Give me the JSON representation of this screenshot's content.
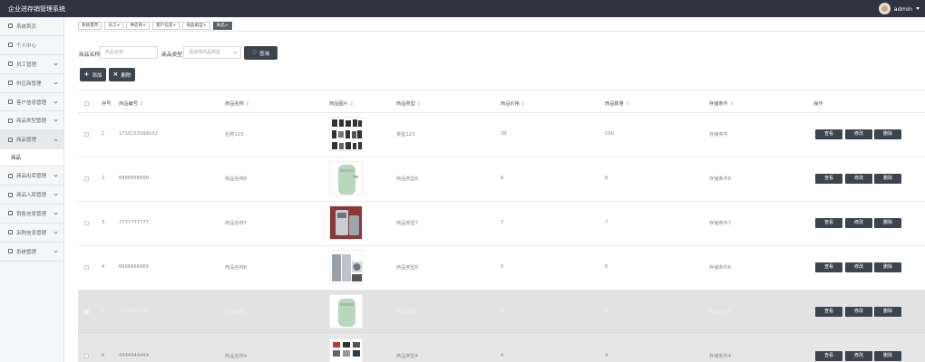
{
  "app": {
    "title": "企业进存销管理系统",
    "user": "admin"
  },
  "sidebar": {
    "items_top": [
      {
        "label": "系统首页"
      },
      {
        "label": "个人中心"
      },
      {
        "label": "员工管理"
      },
      {
        "label": "供应商管理"
      },
      {
        "label": "客户信息管理"
      },
      {
        "label": "商品类型管理"
      },
      {
        "label": "商品管理"
      }
    ],
    "sub_label": "商品",
    "items_bottom": [
      {
        "label": "商品出库管理"
      },
      {
        "label": "商品入库管理"
      },
      {
        "label": "销售信息管理"
      },
      {
        "label": "采购信息管理"
      },
      {
        "label": "系统管理"
      }
    ]
  },
  "tabs": [
    {
      "label": "系统首页"
    },
    {
      "label": "员工×"
    },
    {
      "label": "供应商×"
    },
    {
      "label": "客户信息×"
    },
    {
      "label": "商品类型×"
    },
    {
      "label": "商品×"
    }
  ],
  "search": {
    "name_label": "商品名称",
    "name_placeholder": "商品名称",
    "type_label": "商品类型",
    "type_placeholder": "请选择商品类型",
    "query_button": "查询"
  },
  "toolbar": {
    "add_label": "添加",
    "delete_label": "删除"
  },
  "table": {
    "headers": [
      "序号",
      "商品编号",
      "商品名称",
      "商品图片",
      "商品类型",
      "商品价格",
      "商品数量",
      "存储条件",
      "操作"
    ],
    "actions": {
      "view": "查看",
      "edit": "修改",
      "delete": "删除"
    },
    "rows": [
      {
        "index": "1",
        "code": "1710153399102",
        "name": "名称123",
        "type": "类型123",
        "price": "39",
        "qty": "100",
        "storage": "存储条件"
      },
      {
        "index": "2",
        "code": "8888888888",
        "name": "商品名称8",
        "type": "商品类型8",
        "price": "8",
        "qty": "8",
        "storage": "存储条件8"
      },
      {
        "index": "3",
        "code": "7777777777",
        "name": "商品名称7",
        "type": "商品类型7",
        "price": "7",
        "qty": "7",
        "storage": "存储条件7"
      },
      {
        "index": "4",
        "code": "6666666666",
        "name": "商品名称6",
        "type": "商品类型6",
        "price": "6",
        "qty": "6",
        "storage": "存储条件6"
      },
      {
        "index": "5",
        "code": "5555555555",
        "name": "商品名称5",
        "type": "商品类型5",
        "price": "5",
        "qty": "5",
        "storage": "存储条件5"
      },
      {
        "index": "6",
        "code": "4444444444",
        "name": "商品名称4",
        "type": "商品类型4",
        "price": "4",
        "qty": "4",
        "storage": "存储条件4"
      }
    ]
  }
}
